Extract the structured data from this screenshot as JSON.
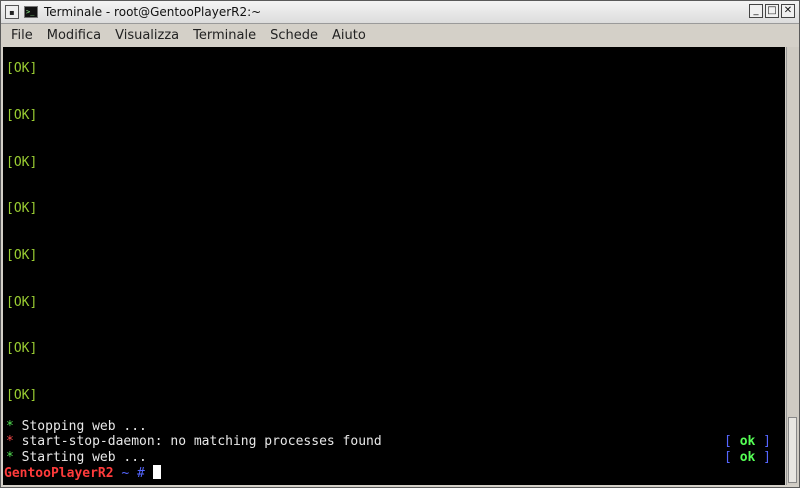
{
  "window": {
    "title": "Terminale - root@GentooPlayerR2:~",
    "minimize_glyph": "_",
    "maximize_glyph": "□",
    "close_glyph": "✕"
  },
  "menubar": {
    "items": [
      "File",
      "Modifica",
      "Visualizza",
      "Terminale",
      "Schede",
      "Aiuto"
    ]
  },
  "terminal": {
    "ok_lines": [
      "[OK]",
      "[OK]",
      "[OK]",
      "[OK]",
      "[OK]",
      "[OK]",
      "[OK]",
      "[OK]"
    ],
    "messages": [
      {
        "bullet": "*",
        "text": "Stopping web ..."
      },
      {
        "bullet": "*",
        "text": "start-stop-daemon: no matching processes found"
      },
      {
        "bullet": "*",
        "text": "Starting web ..."
      }
    ],
    "status_open": "[",
    "status_ok": "ok",
    "status_close": "]",
    "prompt_host": "GentooPlayerR2",
    "prompt_path": "~ #"
  }
}
